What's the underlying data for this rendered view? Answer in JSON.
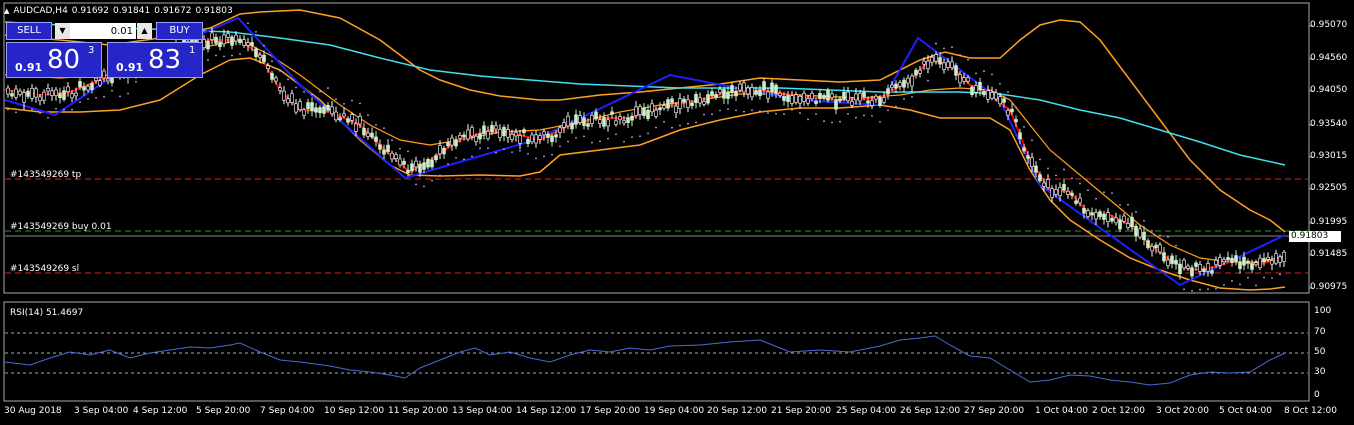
{
  "header": {
    "icon": "triangle-up-icon",
    "symbol": "AUDCAD,H4",
    "open": "0.91692",
    "high": "0.91841",
    "low": "0.91672",
    "close": "0.91803"
  },
  "trade_panel": {
    "sell_label": "SELL",
    "buy_label": "BUY",
    "lot": "0.01",
    "sell_prefix": "0.91",
    "sell_big": "80",
    "sell_sup": "3",
    "buy_prefix": "0.91",
    "buy_big": "83",
    "buy_sup": "1"
  },
  "orders": {
    "tp_label": "#143549269 tp",
    "buy_label": "#143549269 buy 0.01",
    "sl_label": "#143549269 sl"
  },
  "price_axis": [
    "0.95070",
    "0.94560",
    "0.94050",
    "0.93540",
    "0.93015",
    "0.92505",
    "0.91995",
    "0.91485",
    "0.90975"
  ],
  "current_price": "0.91803",
  "time_axis": [
    "30 Aug 2018",
    "3 Sep 04:00",
    "4 Sep 12:00",
    "5 Sep 20:00",
    "7 Sep 04:00",
    "10 Sep 12:00",
    "11 Sep 20:00",
    "13 Sep 04:00",
    "14 Sep 12:00",
    "17 Sep 20:00",
    "19 Sep 04:00",
    "20 Sep 12:00",
    "21 Sep 20:00",
    "25 Sep 04:00",
    "26 Sep 12:00",
    "27 Sep 20:00",
    "1 Oct 04:00",
    "2 Oct 12:00",
    "3 Oct 20:00",
    "5 Oct 04:00",
    "8 Oct 12:00"
  ],
  "rsi": {
    "label": "RSI(14) 51.4697",
    "scale": [
      "100",
      "70",
      "50",
      "30",
      "0"
    ]
  },
  "colors": {
    "background": "#000000",
    "bull_candle": "#c8f0c8",
    "bear_candle": "#ffffff",
    "ma_fast": "#ff0000",
    "ma_slow": "#40e0f0",
    "bollinger": "#ffa020",
    "zigzag": "#2020ff",
    "parabolic_sar": "#c0a0ff",
    "rsi_line": "#4a6cd4",
    "tp_sl_line": "#e02020",
    "buy_line": "#20a020",
    "button": "#2525c8"
  }
}
